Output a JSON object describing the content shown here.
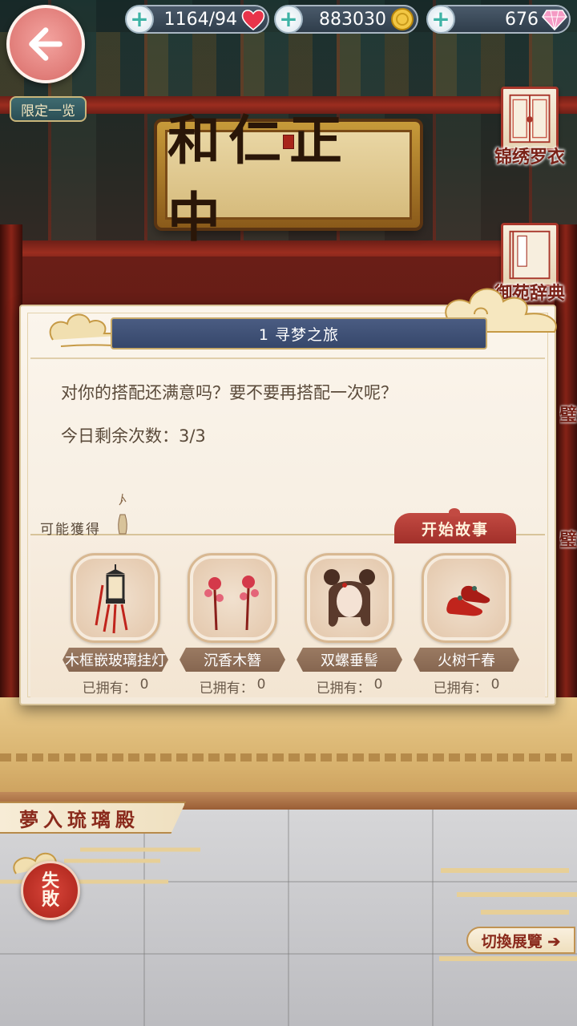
{
  "resources": {
    "stamina": "1164/94",
    "coins": "883030",
    "gems": "676"
  },
  "scene": {
    "plaque_text": "和仁正中"
  },
  "left_menu": {
    "limited_label": "限定一览"
  },
  "right_menu": {
    "brocade_label": "锦绣罗衣",
    "dictionary_label": "御苑辞典",
    "partial_1": "璧",
    "partial_2": "璧"
  },
  "dialog": {
    "title": "1 寻梦之旅",
    "message": "对你的搭配还满意吗？要不要再搭配一次呢？",
    "remaining_label": "今日剩余次数：",
    "remaining_value": "3/3",
    "rewards_label": "可能獲得",
    "start_button": "开始故事",
    "rewards": [
      {
        "name": "木框嵌玻璃挂灯",
        "owned_label": "已拥有：",
        "owned_count": "0",
        "icon": "lantern-icon"
      },
      {
        "name": "沉香木簪",
        "owned_label": "已拥有：",
        "owned_count": "0",
        "icon": "hairpin-icon"
      },
      {
        "name": "双螺垂髻",
        "owned_label": "已拥有：",
        "owned_count": "0",
        "icon": "hairstyle-icon"
      },
      {
        "name": "火树千春",
        "owned_label": "已拥有：",
        "owned_count": "0",
        "icon": "shoes-icon"
      }
    ]
  },
  "bottom": {
    "stage_title": "夢入琉璃殿",
    "fail_top": "失",
    "fail_bottom": "敗",
    "switch_button": "切換展覽 ➔"
  },
  "colors": {
    "title_bar": "#36476b",
    "start_button": "#a2302a",
    "back_button": "#e07c78"
  }
}
